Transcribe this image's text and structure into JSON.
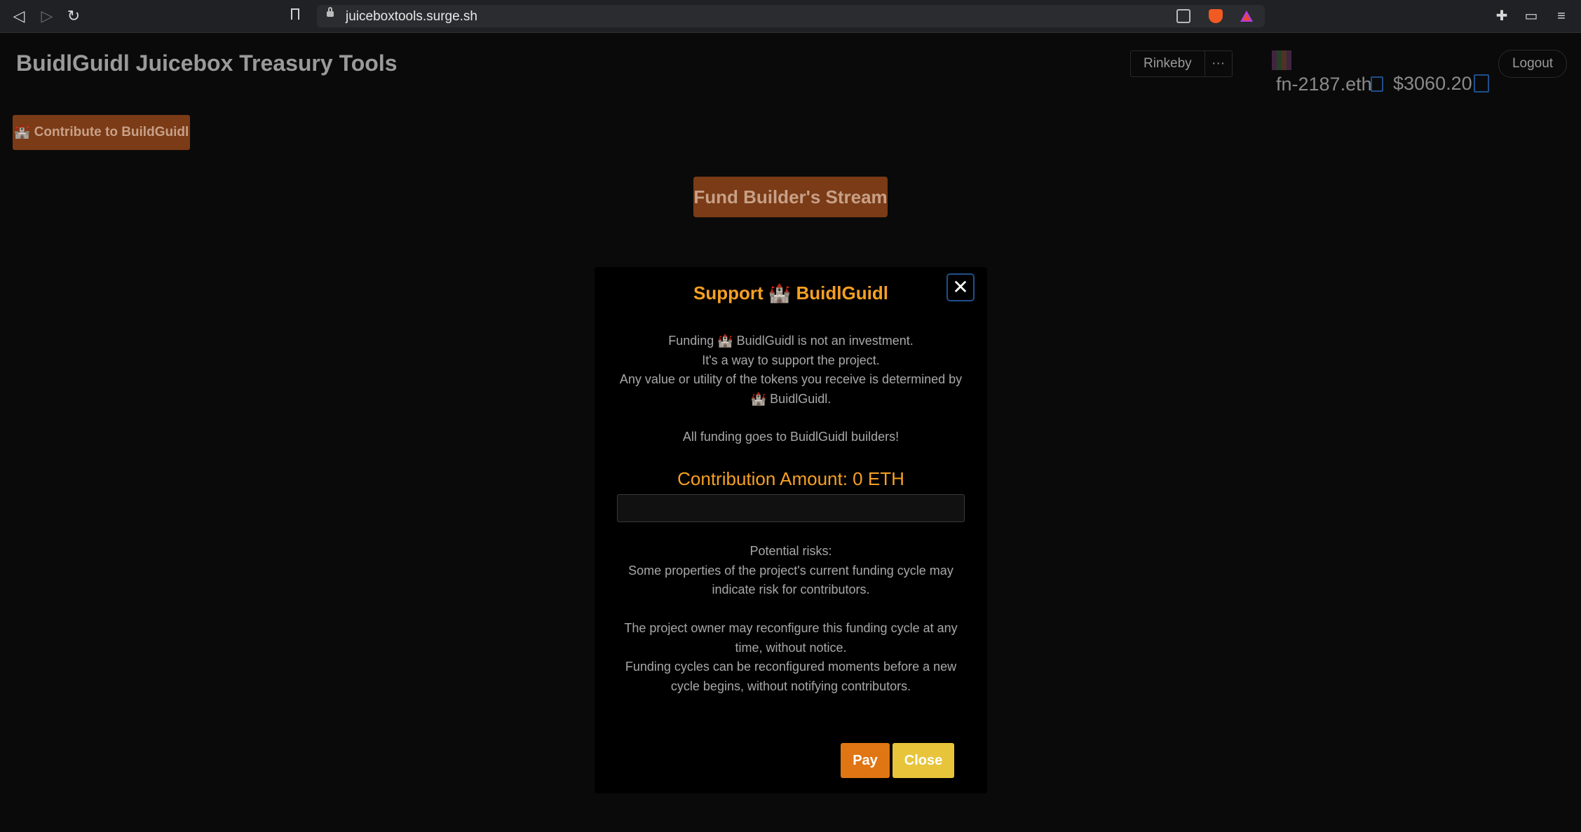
{
  "browser": {
    "url": "juiceboxtools.surge.sh"
  },
  "header": {
    "title": "BuidlGuidl Juicebox Treasury Tools",
    "network_label": "Rinkeby",
    "more_label": "···",
    "logout_label": "Logout",
    "address": "fn-2187.eth",
    "balance": "$3060.20"
  },
  "buttons": {
    "contribute_label": "🏰 Contribute to BuildGuidl",
    "fund_label": "Fund Builder's Stream"
  },
  "modal": {
    "title": "Support 🏰 BuidlGuidl",
    "close_glyph": "✕",
    "disclaimer_lines": [
      "Funding 🏰 BuidlGuidl is not an investment.",
      "It's a way to support the project.",
      "Any value or utility of the tokens you receive is determined by",
      "🏰 BuidlGuidl."
    ],
    "all_funding": "All funding goes to BuidlGuidl builders!",
    "amount_label": "Contribution Amount: 0 ETH",
    "amount_value": "",
    "risks_title": "Potential risks:",
    "risks_line1": "Some properties of the project's current funding cycle may",
    "risks_line2": "indicate risk for contributors.",
    "owner_line1": "The project owner may reconfigure this funding cycle at any",
    "owner_line2": "time, without notice.",
    "cycle_line1": "Funding cycles can be reconfigured moments before a new",
    "cycle_line2": "cycle begins, without notifying contributors.",
    "pay_label": "Pay",
    "close_label": "Close"
  }
}
